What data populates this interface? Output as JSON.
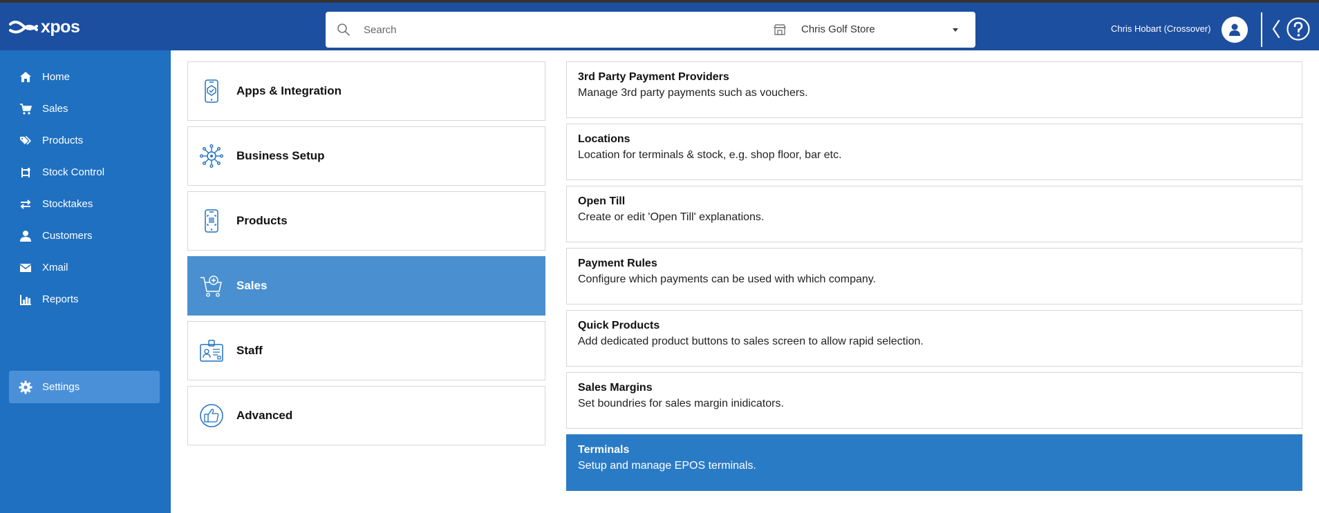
{
  "app": {
    "logo_text": "xpos"
  },
  "header": {
    "search_placeholder": "Search",
    "store_name": "Chris Golf Store",
    "user_name": "Chris Hobart (Crossover)"
  },
  "sidebar": {
    "items": [
      {
        "label": "Home",
        "icon": "home-icon"
      },
      {
        "label": "Sales",
        "icon": "cart-icon"
      },
      {
        "label": "Products",
        "icon": "tags-icon"
      },
      {
        "label": "Stock Control",
        "icon": "stock-control-icon"
      },
      {
        "label": "Stocktakes",
        "icon": "transfer-arrows-icon"
      },
      {
        "label": "Customers",
        "icon": "person-icon"
      },
      {
        "label": "Xmail",
        "icon": "envelope-icon"
      },
      {
        "label": "Reports",
        "icon": "bar-chart-icon"
      },
      {
        "label": "Settings",
        "icon": "gear-icon",
        "active": true
      }
    ]
  },
  "categories": [
    {
      "label": "Apps & Integration",
      "icon": "phone-app-icon"
    },
    {
      "label": "Business Setup",
      "icon": "network-hub-icon"
    },
    {
      "label": "Products",
      "icon": "phone-barcode-icon"
    },
    {
      "label": "Sales",
      "icon": "cart-add-icon",
      "active": true
    },
    {
      "label": "Staff",
      "icon": "id-badge-icon"
    },
    {
      "label": "Advanced",
      "icon": "thumbs-up-icon"
    }
  ],
  "options": [
    {
      "title": "3rd Party Payment Providers",
      "description": "Manage 3rd party payments such as vouchers."
    },
    {
      "title": "Locations",
      "description": "Location for terminals & stock, e.g. shop floor, bar etc."
    },
    {
      "title": "Open Till",
      "description": "Create or edit 'Open Till' explanations."
    },
    {
      "title": "Payment Rules",
      "description": "Configure which payments can be used with which company."
    },
    {
      "title": "Quick Products",
      "description": "Add dedicated product buttons to sales screen to allow rapid selection."
    },
    {
      "title": "Sales Margins",
      "description": "Set boundries for sales margin inidicators."
    },
    {
      "title": "Terminals",
      "description": "Setup and manage EPOS terminals.",
      "active": true
    }
  ],
  "colors": {
    "header_bg": "#1d4fa0",
    "sidebar_bg": "#1f70c1",
    "sidebar_active": "#4a90d9",
    "category_active": "#4a90d0",
    "option_active": "#2a7bc6",
    "icon_outline": "#1f70c1"
  }
}
